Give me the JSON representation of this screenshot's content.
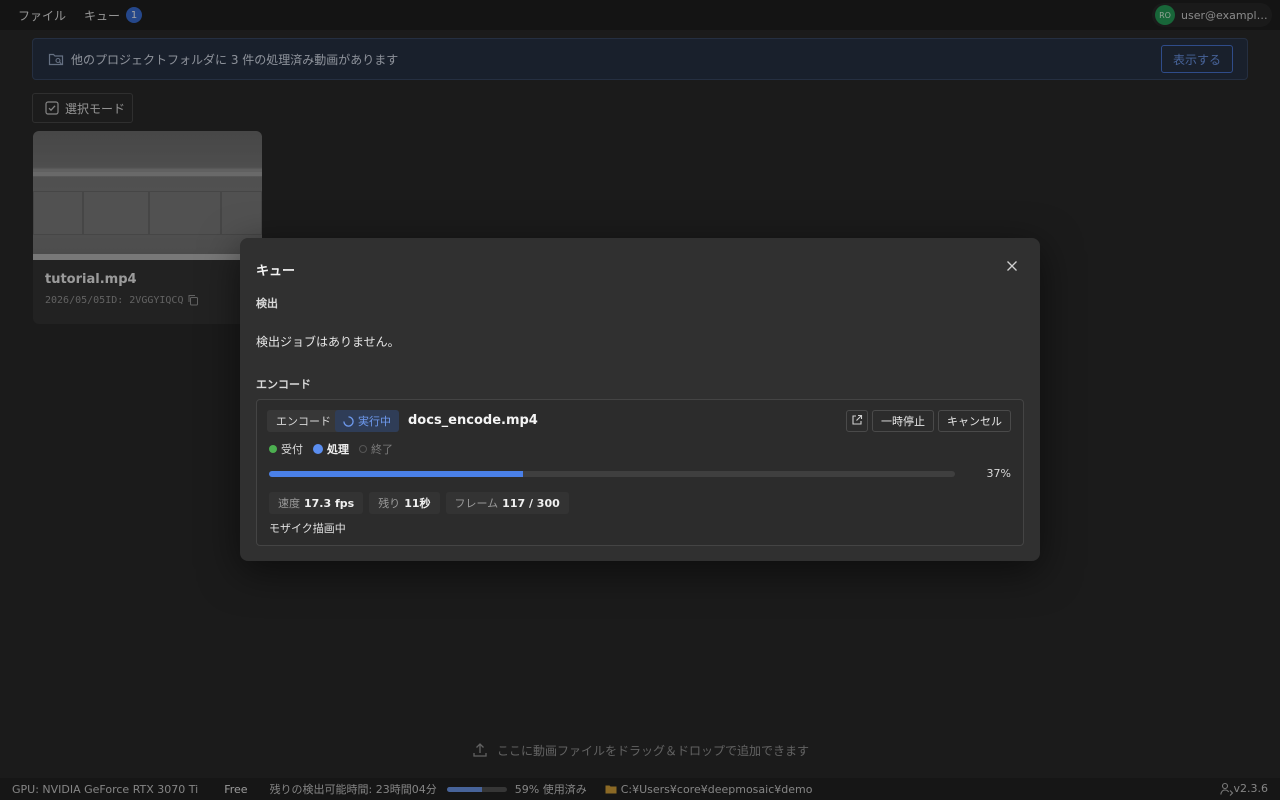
{
  "menubar": {
    "file": "ファイル",
    "queue": "キュー",
    "queue_count": "1",
    "user_initials": "RO",
    "user_email": "user@example...."
  },
  "notice": {
    "text": "他のプロジェクトフォルダに 3 件の処理済み動画があります",
    "button": "表示する"
  },
  "select_mode": "選択モード",
  "video_card": {
    "title": "tutorial.mp4",
    "meta": "2026/05/05ID: 2VGGYIQCQ"
  },
  "dropzone": "ここに動画ファイルをドラッグ＆ドロップで追加できます",
  "statusbar": {
    "gpu": "GPU: NVIDIA GeForce RTX 3070 Ti",
    "plan": "Free",
    "remaining": "残りの検出可能時間: 23時間04分",
    "usage_fraction": 0.59,
    "used": "59% 使用済み",
    "path": "C:¥Users¥core¥deepmosaic¥demo",
    "version": "v2.3.6"
  },
  "modal": {
    "title": "キュー",
    "detect_heading": "検出",
    "detect_empty": "検出ジョブはありません。",
    "encode_heading": "エンコード",
    "job": {
      "kind": "エンコード",
      "state": "実行中",
      "filename": "docs_encode.mp4",
      "pause": "一時停止",
      "cancel": "キャンセル",
      "steps": [
        "受付",
        "処理",
        "終了"
      ],
      "progress_fraction": 0.37,
      "progress_text": "37%",
      "speed_label": "速度",
      "speed_value": "17.3 fps",
      "remain_label": "残り",
      "remain_value": "11秒",
      "frames_label": "フレーム",
      "frames_value": "117 / 300",
      "message": "モザイク描画中"
    }
  },
  "colors": {
    "accent": "#4a80e8",
    "success": "#4caf50",
    "avatar": "#27a05a"
  }
}
